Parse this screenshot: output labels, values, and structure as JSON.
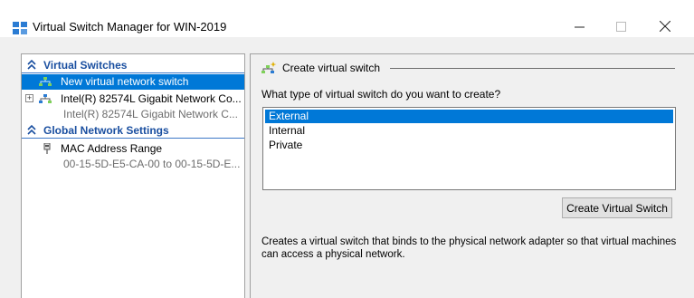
{
  "window": {
    "title": "Virtual Switch Manager for WIN-2019",
    "controls": {
      "minimize": "—",
      "maximize": "☐",
      "close": "✕"
    }
  },
  "left_pane": {
    "virtual_switches": {
      "header": "Virtual Switches",
      "items": [
        {
          "label": "New virtual network switch",
          "selected": true
        },
        {
          "label": "Intel(R) 82574L Gigabit Network Co...",
          "sub": "Intel(R) 82574L Gigabit Network C...",
          "expander": "+"
        }
      ]
    },
    "global_settings": {
      "header": "Global Network Settings",
      "items": [
        {
          "label": "MAC Address Range",
          "sub": "00-15-5D-E5-CA-00 to 00-15-5D-E..."
        }
      ]
    }
  },
  "right_pane": {
    "group_title": "Create virtual switch",
    "question": "What type of virtual switch do you want to create?",
    "options": [
      {
        "label": "External",
        "selected": true
      },
      {
        "label": "Internal",
        "selected": false
      },
      {
        "label": "Private",
        "selected": false
      }
    ],
    "create_button": "Create Virtual Switch",
    "description": "Creates a virtual switch that binds to the physical network adapter so that virtual machines can access a physical network."
  },
  "colors": {
    "selection": "#0078d7",
    "header_blue": "#1a4fa0",
    "pane_bg": "#f0f0f0"
  },
  "icons": [
    "app-icon",
    "collapse-chevron-icon",
    "network-switch-icon",
    "network-adapter-icon",
    "mac-address-icon",
    "create-switch-icon"
  ]
}
